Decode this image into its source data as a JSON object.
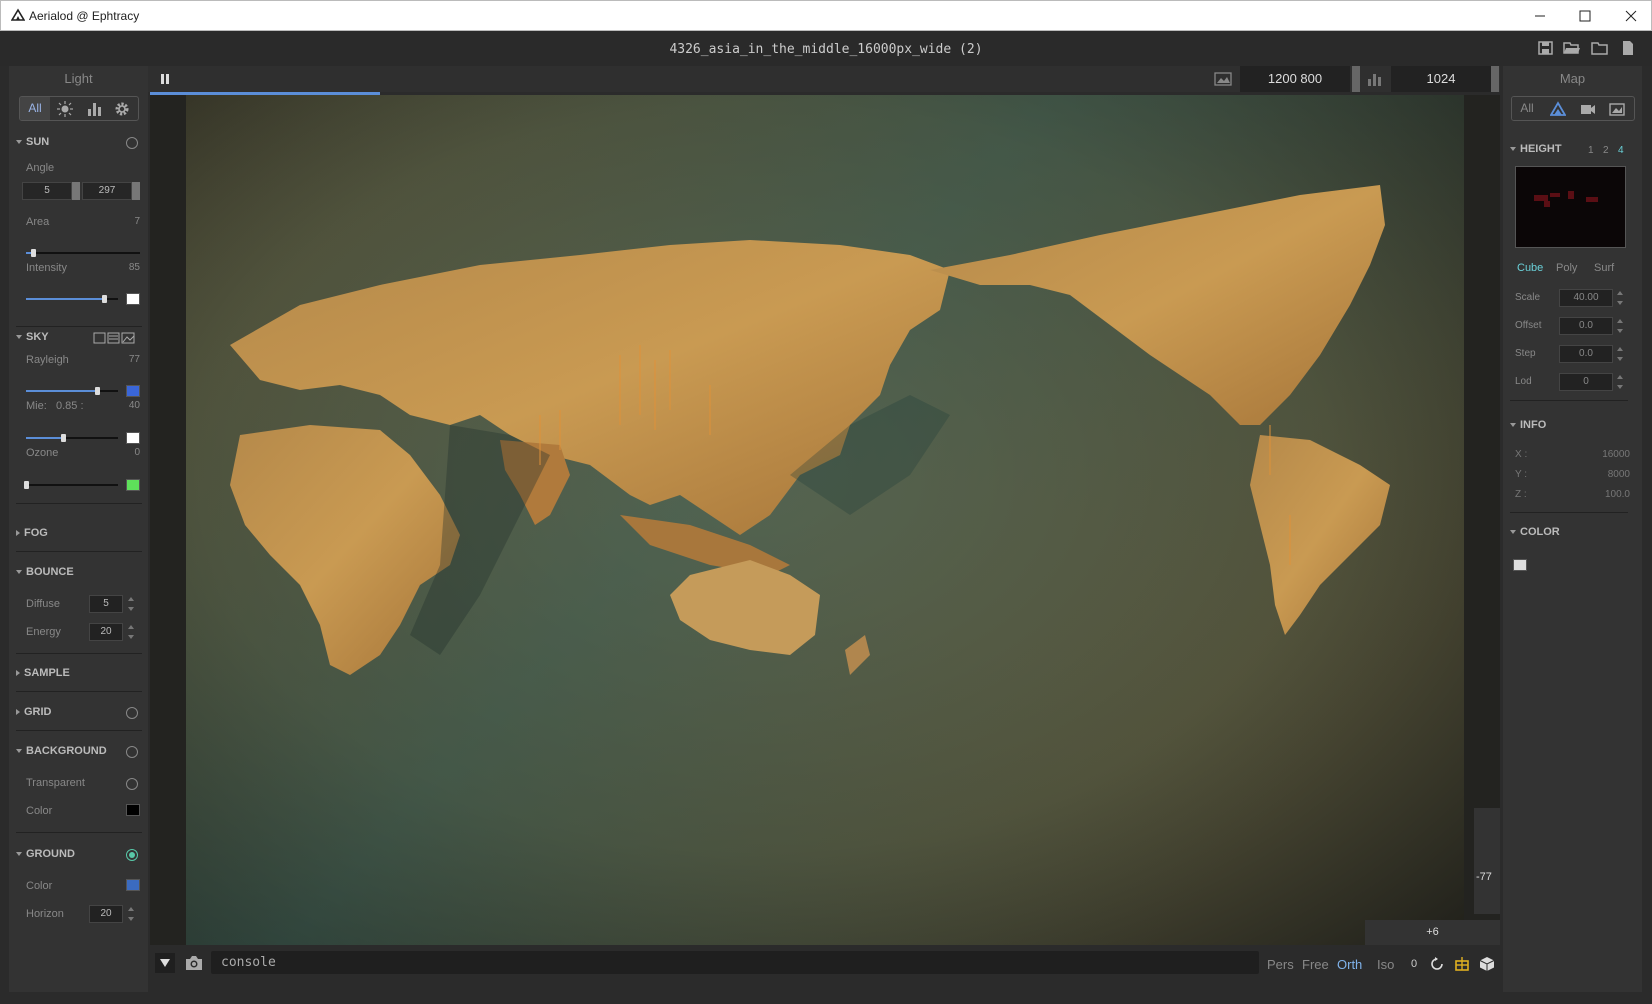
{
  "window": {
    "title": "Aerialod @ Ephtracy"
  },
  "document": {
    "title": "4326_asia_in_the_middle_16000px_wide (2)"
  },
  "left_panel": {
    "title": "Light",
    "filter_all": "All",
    "sun": {
      "label": "SUN",
      "angle_label": "Angle",
      "angle_a": "5",
      "angle_b": "297",
      "area_label": "Area",
      "area_value": "7",
      "area_pct": 0.06,
      "intensity_label": "Intensity",
      "intensity_value": "85",
      "intensity_pct": 0.85,
      "intensity_color": "#ffffff"
    },
    "sky": {
      "label": "SKY",
      "rayleigh_label": "Rayleigh",
      "rayleigh_value": "77",
      "rayleigh_pct": 0.77,
      "rayleigh_color": "#3a66d8",
      "mie_label": "Mie:",
      "mie_sub": "0.85 :",
      "mie_value": "40",
      "mie_pct": 0.4,
      "mie_color": "#ffffff",
      "ozone_label": "Ozone",
      "ozone_value": "0",
      "ozone_pct": 0.0,
      "ozone_color": "#5ee05a"
    },
    "fog": {
      "label": "FOG"
    },
    "bounce": {
      "label": "BOUNCE",
      "diffuse_label": "Diffuse",
      "diffuse_value": "5",
      "energy_label": "Energy",
      "energy_value": "20"
    },
    "sample": {
      "label": "SAMPLE"
    },
    "grid": {
      "label": "GRID"
    },
    "background": {
      "label": "BACKGROUND",
      "transparent_label": "Transparent",
      "color_label": "Color",
      "color": "#000000"
    },
    "ground": {
      "label": "GROUND",
      "color_label": "Color",
      "color": "#3b6bc0",
      "horizon_label": "Horizon",
      "horizon_value": "20"
    }
  },
  "viewport": {
    "resolution": "1200  800",
    "samples": "1024",
    "zoom": "-77",
    "offset": "+6"
  },
  "right_panel": {
    "title": "Map",
    "filter_all": "All",
    "height": {
      "label": "HEIGHT",
      "levels": [
        "1",
        "2",
        "4"
      ]
    },
    "tabs": [
      "Cube",
      "Poly",
      "Surf"
    ],
    "scale_label": "Scale",
    "scale_value": "40.00",
    "offset_label": "Offset",
    "offset_value": "0.0",
    "step_label": "Step",
    "step_value": "0.0",
    "lod_label": "Lod",
    "lod_value": "0",
    "info": {
      "label": "INFO",
      "x_label": "X :",
      "x_value": "16000",
      "y_label": "Y :",
      "y_value": "8000",
      "z_label": "Z :",
      "z_value": "100.0"
    },
    "color": {
      "label": "COLOR",
      "swatch": "#dddddd"
    }
  },
  "bottom": {
    "console_text": "console",
    "modes": [
      "Pers",
      "Free",
      "Orth",
      "Iso"
    ],
    "active_mode": "Orth",
    "angle_value": "0"
  }
}
